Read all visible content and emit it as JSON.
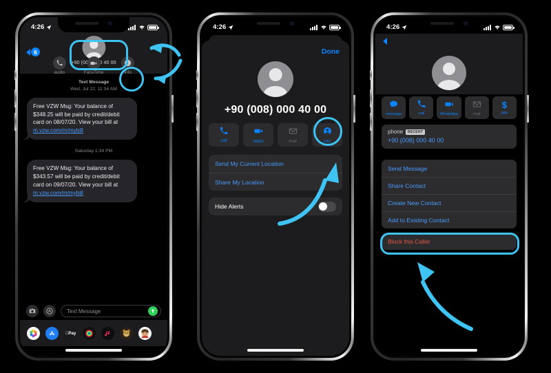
{
  "meta": {
    "accent_highlight": "#3fc3f2",
    "ios_blue": "#0a84ff",
    "danger_red": "#e8554a",
    "screen_bg": "#000000",
    "card_bg": "#2c2c2e"
  },
  "status_bar": {
    "time": "4:26",
    "location_icon": "location-arrow-icon",
    "signal_icon": "cellular-bars-icon",
    "wifi_icon": "wifi-icon",
    "battery_icon": "battery-icon"
  },
  "phone1": {
    "name": "messages-conversation-screen",
    "nav": {
      "back_icon": "chevron-left-icon",
      "unread_badge": "6",
      "avatar_icon": "contact-avatar-icon",
      "contact_number": "+90 (008) 000 40 00",
      "chevron_icon": "chevron-down-icon",
      "actions": [
        {
          "label": "audio",
          "icon": "phone-icon"
        },
        {
          "label": "FaceTime",
          "icon": "video-camera-icon"
        },
        {
          "label": "info",
          "icon": "info-circle-icon"
        }
      ]
    },
    "thread": [
      {
        "stamp_title": "Text Message",
        "stamp_time": "Wed, Jul 22, 11:34 AM",
        "text_before_link": "Free VZW Msg: Your balance of $348.25 will be paid by credit/debit card on 08/07/20. View your bill at ",
        "link": "m.vzw.com/m/mybill"
      },
      {
        "stamp_title": "",
        "stamp_time": "Saturday 1:34 PM",
        "text_before_link": "Free VZW Msg: Your balance of $343.57 will be paid by credit/debit card on 09/07/20. View your bill at ",
        "link": "m.vzw.com/m/mybill"
      }
    ],
    "input_bar": {
      "camera_icon": "camera-icon",
      "apps_icon": "app-store-icon",
      "placeholder": "Text Message",
      "send_icon": "send-arrow-up-icon"
    },
    "app_drawer": [
      {
        "icon": "photos-icon"
      },
      {
        "icon": "app-store-icon"
      },
      {
        "icon": "apple-pay-icon"
      },
      {
        "icon": "activity-rings-icon"
      },
      {
        "icon": "music-icon"
      },
      {
        "icon": "memoji-bear-icon"
      },
      {
        "icon": "memoji-person-icon"
      }
    ]
  },
  "phone2": {
    "name": "conversation-details-sheet",
    "done_label": "Done",
    "avatar_icon": "contact-avatar-icon",
    "number": "+90 (008) 000 40 00",
    "tiles": [
      {
        "label": "call",
        "icon": "phone-icon",
        "disabled": false
      },
      {
        "label": "video",
        "icon": "video-camera-icon",
        "disabled": false
      },
      {
        "label": "mail",
        "icon": "envelope-icon",
        "disabled": true
      },
      {
        "label": "info",
        "icon": "person-circle-icon",
        "disabled": false
      }
    ],
    "location_rows": [
      "Send My Current Location",
      "Share My Location"
    ],
    "hide_alerts": {
      "label": "Hide Alerts",
      "toggle_state": "off"
    }
  },
  "phone3": {
    "name": "contact-info-screen",
    "back_icon": "chevron-left-icon",
    "avatar_icon": "contact-avatar-icon",
    "tiles": [
      {
        "label": "message",
        "icon": "message-bubble-icon",
        "disabled": false
      },
      {
        "label": "call",
        "icon": "phone-icon",
        "disabled": false
      },
      {
        "label": "WhatsApp",
        "icon": "video-camera-icon",
        "disabled": false
      },
      {
        "label": "mail",
        "icon": "envelope-icon",
        "disabled": true
      },
      {
        "label": "pay",
        "icon": "dollar-sign-icon",
        "disabled": false
      }
    ],
    "phone_field": {
      "label": "phone",
      "badge": "RECENT",
      "value": "+90 (008) 000 40 00"
    },
    "actions": [
      "Send Message",
      "Share Contact",
      "Create New Contact",
      "Add to Existing Contact"
    ],
    "block_action": "Block this Caller"
  }
}
